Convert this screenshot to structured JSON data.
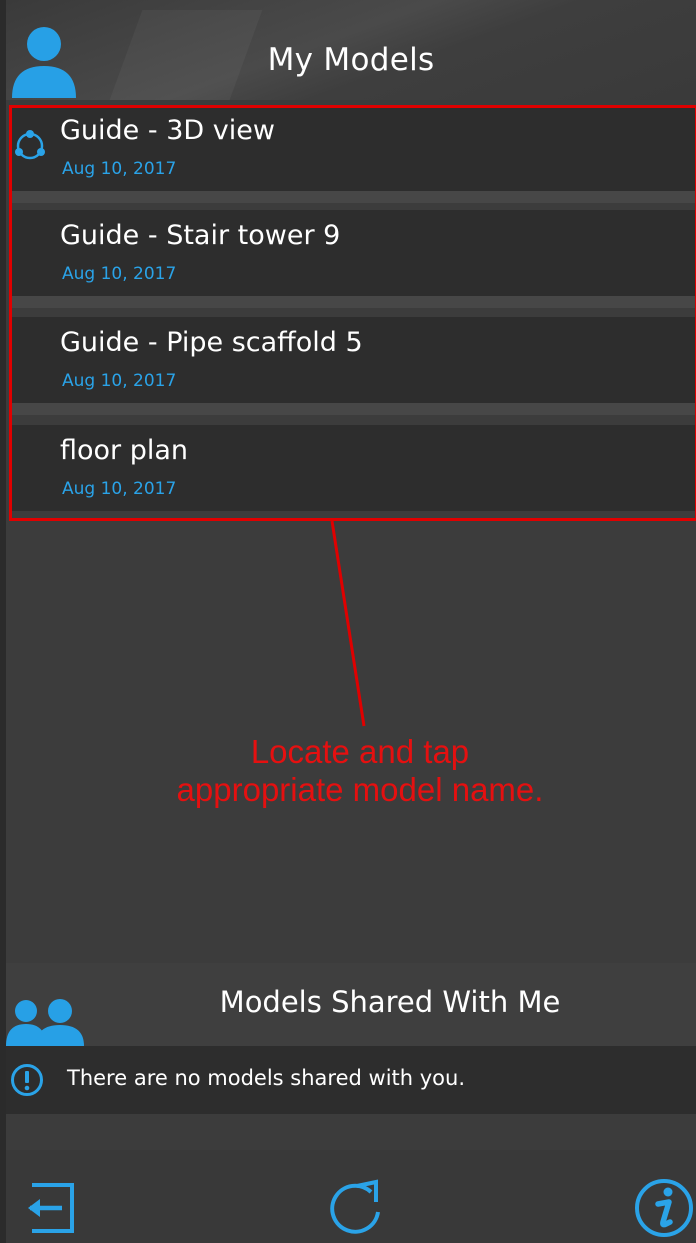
{
  "header": {
    "title": "My Models"
  },
  "models": [
    {
      "name": "Guide - 3D view",
      "date": "Aug 10, 2017",
      "synced": true
    },
    {
      "name": "Guide - Stair tower 9",
      "date": "Aug 10, 2017",
      "synced": false
    },
    {
      "name": "Guide - Pipe scaffold 5",
      "date": "Aug 10, 2017",
      "synced": false
    },
    {
      "name": "floor plan",
      "date": "Aug 10, 2017",
      "synced": false
    }
  ],
  "annotation": {
    "line1": "Locate and tap",
    "line2": "appropriate model name."
  },
  "shared": {
    "title": "Models Shared With Me",
    "empty_message": "There are no models shared with you."
  },
  "toolbar": {
    "icons": [
      "logout-icon",
      "refresh-icon",
      "info-icon"
    ]
  },
  "colors": {
    "accent": "#2aa3e8",
    "annotation": "#e00000",
    "background": "#3c3c3c",
    "row": "#2d2d2d"
  }
}
